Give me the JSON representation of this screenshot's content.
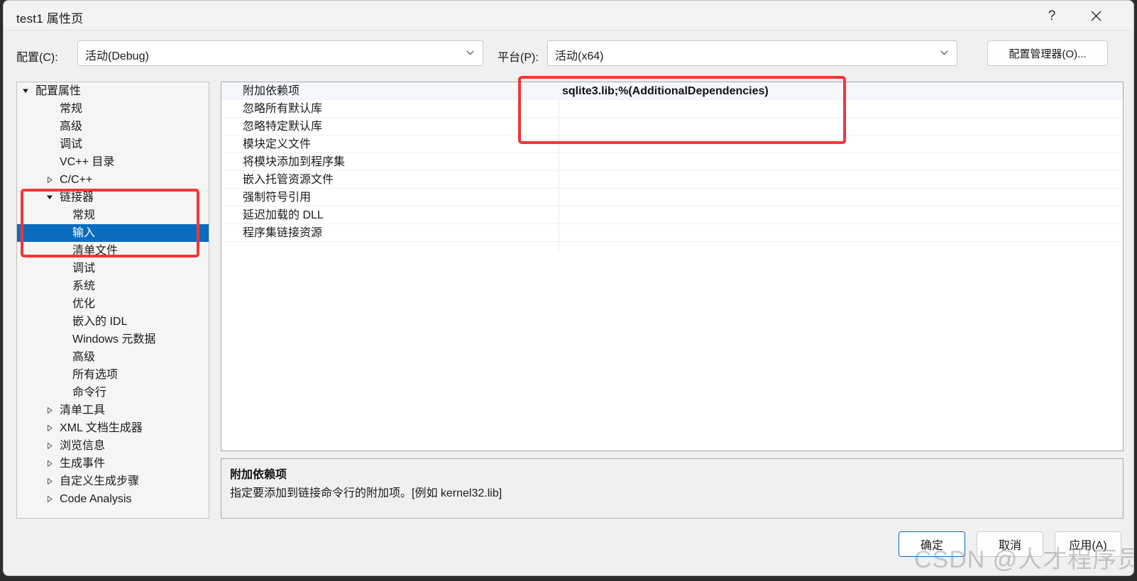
{
  "window": {
    "title": "test1 属性页",
    "help_icon": "question-mark-icon",
    "close_icon": "close-x-icon"
  },
  "config_bar": {
    "config_label": "配置(C):",
    "config_value": "活动(Debug)",
    "platform_label": "平台(P):",
    "platform_value": "活动(x64)",
    "config_manager_button": "配置管理器(O)..."
  },
  "tree": {
    "items": [
      {
        "label": "配置属性",
        "indent": 0,
        "arrow": "expanded",
        "selected": false
      },
      {
        "label": "常规",
        "indent": 1,
        "arrow": "none",
        "selected": false
      },
      {
        "label": "高级",
        "indent": 1,
        "arrow": "none",
        "selected": false
      },
      {
        "label": "调试",
        "indent": 1,
        "arrow": "none",
        "selected": false
      },
      {
        "label": "VC++ 目录",
        "indent": 1,
        "arrow": "none",
        "selected": false
      },
      {
        "label": "C/C++",
        "indent": 1,
        "arrow": "collapsed",
        "selected": false
      },
      {
        "label": "链接器",
        "indent": 1,
        "arrow": "expanded",
        "selected": false
      },
      {
        "label": "常规",
        "indent": 2,
        "arrow": "none",
        "selected": false
      },
      {
        "label": "输入",
        "indent": 2,
        "arrow": "none",
        "selected": true
      },
      {
        "label": "清单文件",
        "indent": 2,
        "arrow": "none",
        "selected": false
      },
      {
        "label": "调试",
        "indent": 2,
        "arrow": "none",
        "selected": false
      },
      {
        "label": "系统",
        "indent": 2,
        "arrow": "none",
        "selected": false
      },
      {
        "label": "优化",
        "indent": 2,
        "arrow": "none",
        "selected": false
      },
      {
        "label": "嵌入的 IDL",
        "indent": 2,
        "arrow": "none",
        "selected": false
      },
      {
        "label": "Windows 元数据",
        "indent": 2,
        "arrow": "none",
        "selected": false
      },
      {
        "label": "高级",
        "indent": 2,
        "arrow": "none",
        "selected": false
      },
      {
        "label": "所有选项",
        "indent": 2,
        "arrow": "none",
        "selected": false
      },
      {
        "label": "命令行",
        "indent": 2,
        "arrow": "none",
        "selected": false
      },
      {
        "label": "清单工具",
        "indent": 1,
        "arrow": "collapsed",
        "selected": false
      },
      {
        "label": "XML 文档生成器",
        "indent": 1,
        "arrow": "collapsed",
        "selected": false
      },
      {
        "label": "浏览信息",
        "indent": 1,
        "arrow": "collapsed",
        "selected": false
      },
      {
        "label": "生成事件",
        "indent": 1,
        "arrow": "collapsed",
        "selected": false
      },
      {
        "label": "自定义生成步骤",
        "indent": 1,
        "arrow": "collapsed",
        "selected": false
      },
      {
        "label": "Code Analysis",
        "indent": 1,
        "arrow": "collapsed",
        "selected": false
      }
    ]
  },
  "property_grid": {
    "rows": [
      {
        "name": "附加依赖项",
        "value": "sqlite3.lib;%(AdditionalDependencies)"
      },
      {
        "name": "忽略所有默认库",
        "value": ""
      },
      {
        "name": "忽略特定默认库",
        "value": ""
      },
      {
        "name": "模块定义文件",
        "value": ""
      },
      {
        "name": "将模块添加到程序集",
        "value": ""
      },
      {
        "name": "嵌入托管资源文件",
        "value": ""
      },
      {
        "name": "强制符号引用",
        "value": ""
      },
      {
        "name": "延迟加载的 DLL",
        "value": ""
      },
      {
        "name": "程序集链接资源",
        "value": ""
      }
    ]
  },
  "description": {
    "title": "附加依赖项",
    "text": "指定要添加到链接命令行的附加项。[例如 kernel32.lib]"
  },
  "footer": {
    "ok": "确定",
    "cancel": "取消",
    "apply": "应用(A)"
  },
  "watermark": "CSDN @人才程序员",
  "colors": {
    "selection_blue": "#0a6cbf",
    "annotation_red": "#f83434",
    "dialog_bg": "#f0f0f0",
    "grid_bg": "#ffffff"
  }
}
